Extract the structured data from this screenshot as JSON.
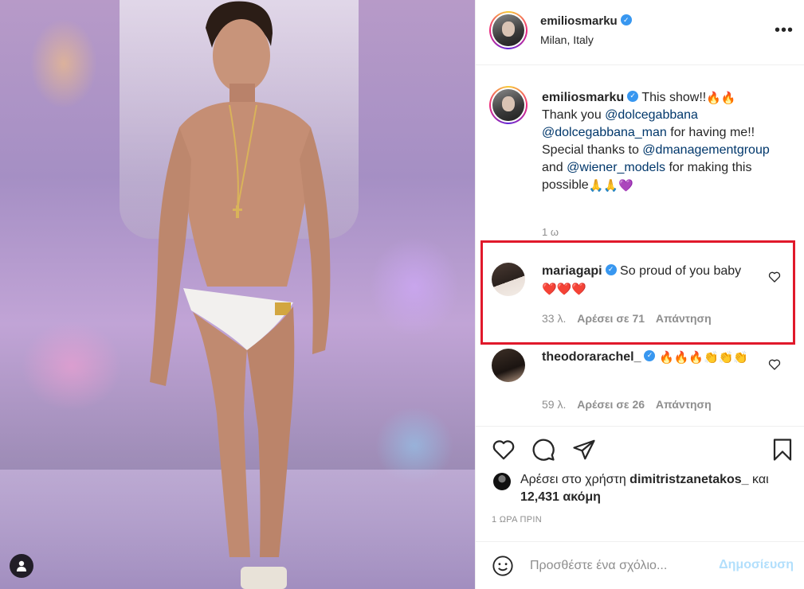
{
  "post": {
    "username": "emiliosmarku",
    "location": "Milan, Italy",
    "more_label": "•••"
  },
  "caption": {
    "username": "emiliosmarku",
    "text_1": "This show!!",
    "text_2": "Thank you ",
    "mention_1": "@dolcegabbana",
    "mention_2": "@dolcegabbana_man",
    "text_3": " for having me!! Special thanks to ",
    "mention_3": "@dmanagementgroup",
    "text_4": " and ",
    "mention_4": "@wiener_models",
    "text_5": " for making this possible",
    "emoji_1": "🔥🔥",
    "emoji_2": "🙏🙏💜",
    "time": "1 ω"
  },
  "comments": [
    {
      "username": "mariagapi",
      "text": "So proud of you baby",
      "emoji": "❤️❤️❤️",
      "age": "33 λ.",
      "likes": "Αρέσει σε 71",
      "reply": "Απάντηση"
    },
    {
      "username": "theodorarachel_",
      "text": "",
      "emoji": "🔥🔥🔥👏👏👏",
      "age": "59 λ.",
      "likes": "Αρέσει σε 26",
      "reply": "Απάντηση"
    }
  ],
  "likes": {
    "prefix": "Αρέσει στο χρήστη ",
    "user": "dimitristzanetakos_",
    "suffix": " και",
    "count": "12,431 ακόμη"
  },
  "post_time": "1 ΩΡΑ ΠΡΙΝ",
  "comment_box": {
    "placeholder": "Προσθέστε ένα σχόλιο...",
    "post_label": "Δημοσίευση"
  },
  "colors": {
    "highlight": "#e0192b",
    "verified": "#3897f0",
    "mention": "#00376b",
    "post_button": "#b2dffc"
  }
}
